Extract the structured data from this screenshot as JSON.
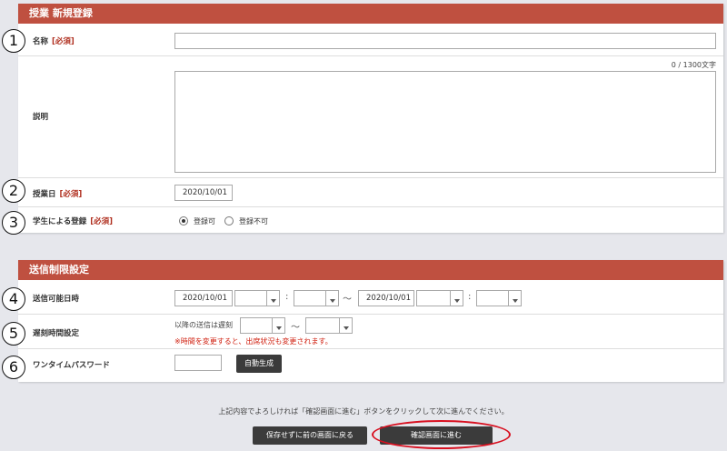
{
  "class_section": {
    "title": "授業 新規登録",
    "name": {
      "label": "名称",
      "required": "[必須]",
      "value": ""
    },
    "description": {
      "label": "説明",
      "counter": "0 / 1300文字",
      "value": ""
    },
    "date": {
      "label": "授業日",
      "required": "[必須]",
      "value": "2020/10/01"
    },
    "student_reg": {
      "label": "学生による登録",
      "required": "[必須]",
      "option_on": "登録可",
      "option_off": "登録不可",
      "selected": "登録可"
    }
  },
  "send_section": {
    "title": "送信制限設定",
    "window": {
      "label": "送信可能日時",
      "start_date": "2020/10/01",
      "end_date": "2020/10/01",
      "colon": ":",
      "tilde": "～"
    },
    "late": {
      "label": "遅刻時間設定",
      "prefix": "以降の送信は遅刻",
      "tilde": "～",
      "note": "※時間を変更すると、出席状況も変更されます。"
    },
    "otp": {
      "label": "ワンタイムパスワード",
      "value": "",
      "generate": "自動生成"
    }
  },
  "footer": {
    "message": "上記内容でよろしければ「確認画面に進む」ボタンをクリックして次に進んでください。",
    "back_label": "保存せずに前の画面に戻る",
    "confirm_label": "確認画面に進む"
  },
  "annotations": {
    "n1": "1",
    "n2": "2",
    "n3": "3",
    "n4": "4",
    "n5": "5",
    "n6": "6"
  },
  "colors": {
    "header": "#bf5040",
    "required": "#b03020",
    "note": "#d02010",
    "highlight": "#d81020"
  }
}
